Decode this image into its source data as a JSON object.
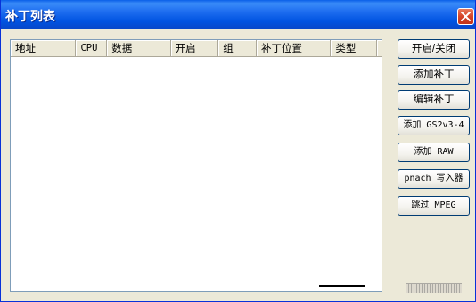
{
  "window": {
    "title": "补丁列表"
  },
  "icons": {
    "close": "close-icon"
  },
  "colors": {
    "titlebar": "#0053e1",
    "close": "#d5452a",
    "face": "#ece9d8"
  },
  "table": {
    "columns": [
      "地址",
      "CPU",
      "数据",
      "开启",
      "组",
      "补丁位置",
      "类型"
    ],
    "rows": []
  },
  "buttons": {
    "toggle": "开启/关闭",
    "add_patch": "添加补丁",
    "edit_patch": "编辑补丁",
    "add_gs2v3": "添加 GS2v3-4",
    "add_raw": "添加 RAW",
    "pnach_write": "pnach 写入器",
    "skip_mpeg": "跳过 MPEG"
  }
}
